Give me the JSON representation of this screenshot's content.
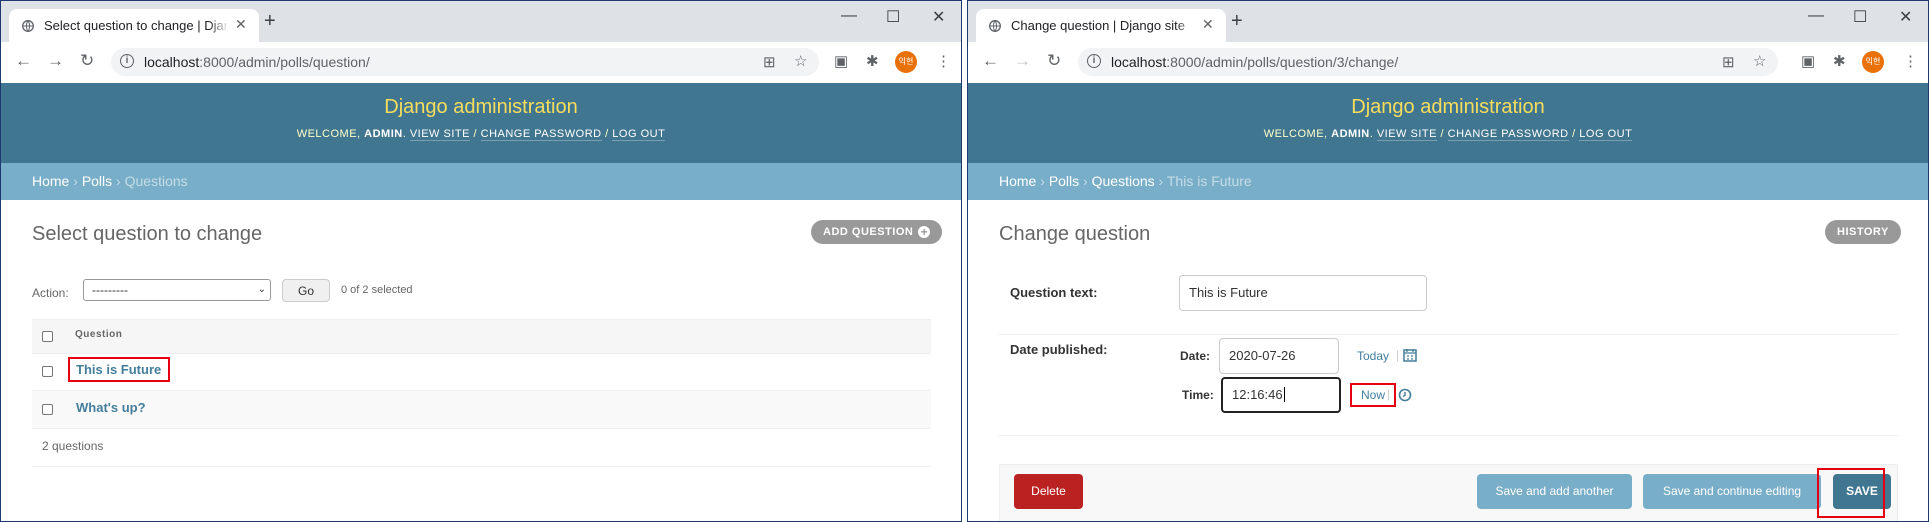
{
  "left": {
    "tab_title": "Select question to change | Django",
    "url_host": "localhost",
    "url_path": ":8000/admin/polls/question/",
    "brand": "Django administration",
    "user_tools": {
      "welcome": "Welcome, ",
      "user": "admin",
      "view_site": "View site",
      "change_password": "Change password",
      "log_out": "Log out"
    },
    "breadcrumbs": {
      "home": "Home",
      "polls": "Polls",
      "current": "Questions"
    },
    "page_title": "Select question to change",
    "add_button": "Add question",
    "action_label": "Action:",
    "action_value": "---------",
    "go_button": "Go",
    "selected_count": "0 of 2 selected",
    "column_header": "Question",
    "rows": [
      "This is Future",
      "What's up?"
    ],
    "total": "2 questions"
  },
  "right": {
    "tab_title": "Change question | Django site",
    "url_host": "localhost",
    "url_path": ":8000/admin/polls/question/3/change/",
    "brand": "Django administration",
    "user_tools": {
      "welcome": "Welcome, ",
      "user": "admin",
      "view_site": "View site",
      "change_password": "Change password",
      "log_out": "Log out"
    },
    "breadcrumbs": {
      "home": "Home",
      "polls": "Polls",
      "questions": "Questions",
      "current": "This is Future"
    },
    "page_title": "Change question",
    "history_button": "History",
    "question_text_label": "Question text:",
    "question_text_value": "This is Future",
    "date_published_label": "Date published:",
    "date_label": "Date:",
    "date_value": "2020-07-26",
    "today_link": "Today",
    "time_label": "Time:",
    "time_value": "12:16:46",
    "now_link": "Now",
    "delete_button": "Delete",
    "save_add_button": "Save and add another",
    "save_continue_button": "Save and continue editing",
    "save_button": "SAVE"
  },
  "avatar_text": "익현",
  "colors": {
    "header": "#417690",
    "breadcrumbs": "#79aec8",
    "brand": "#f5dd5d",
    "link": "#447e9b",
    "delete": "#ba2121",
    "save": "#417690",
    "highlight": "#e60012"
  }
}
